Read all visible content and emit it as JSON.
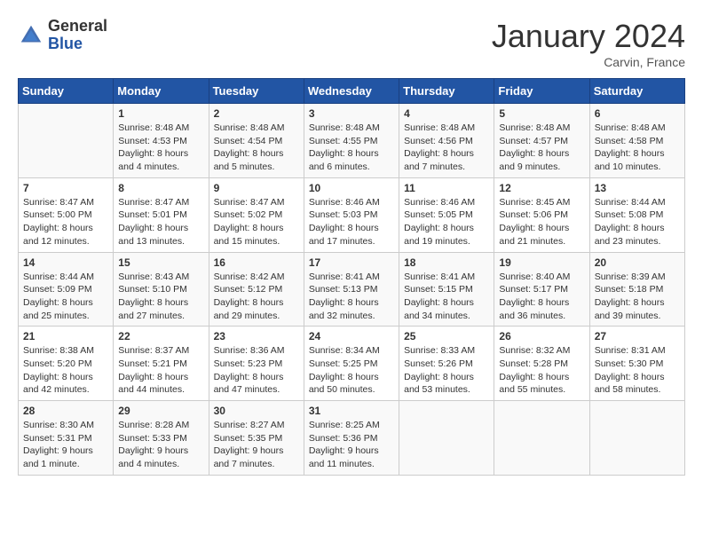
{
  "header": {
    "logo_general": "General",
    "logo_blue": "Blue",
    "month_year": "January 2024",
    "location": "Carvin, France"
  },
  "days_of_week": [
    "Sunday",
    "Monday",
    "Tuesday",
    "Wednesday",
    "Thursday",
    "Friday",
    "Saturday"
  ],
  "weeks": [
    [
      {
        "day": "",
        "sunrise": "",
        "sunset": "",
        "daylight": ""
      },
      {
        "day": "1",
        "sunrise": "Sunrise: 8:48 AM",
        "sunset": "Sunset: 4:53 PM",
        "daylight": "Daylight: 8 hours and 4 minutes."
      },
      {
        "day": "2",
        "sunrise": "Sunrise: 8:48 AM",
        "sunset": "Sunset: 4:54 PM",
        "daylight": "Daylight: 8 hours and 5 minutes."
      },
      {
        "day": "3",
        "sunrise": "Sunrise: 8:48 AM",
        "sunset": "Sunset: 4:55 PM",
        "daylight": "Daylight: 8 hours and 6 minutes."
      },
      {
        "day": "4",
        "sunrise": "Sunrise: 8:48 AM",
        "sunset": "Sunset: 4:56 PM",
        "daylight": "Daylight: 8 hours and 7 minutes."
      },
      {
        "day": "5",
        "sunrise": "Sunrise: 8:48 AM",
        "sunset": "Sunset: 4:57 PM",
        "daylight": "Daylight: 8 hours and 9 minutes."
      },
      {
        "day": "6",
        "sunrise": "Sunrise: 8:48 AM",
        "sunset": "Sunset: 4:58 PM",
        "daylight": "Daylight: 8 hours and 10 minutes."
      }
    ],
    [
      {
        "day": "7",
        "sunrise": "Sunrise: 8:47 AM",
        "sunset": "Sunset: 5:00 PM",
        "daylight": "Daylight: 8 hours and 12 minutes."
      },
      {
        "day": "8",
        "sunrise": "Sunrise: 8:47 AM",
        "sunset": "Sunset: 5:01 PM",
        "daylight": "Daylight: 8 hours and 13 minutes."
      },
      {
        "day": "9",
        "sunrise": "Sunrise: 8:47 AM",
        "sunset": "Sunset: 5:02 PM",
        "daylight": "Daylight: 8 hours and 15 minutes."
      },
      {
        "day": "10",
        "sunrise": "Sunrise: 8:46 AM",
        "sunset": "Sunset: 5:03 PM",
        "daylight": "Daylight: 8 hours and 17 minutes."
      },
      {
        "day": "11",
        "sunrise": "Sunrise: 8:46 AM",
        "sunset": "Sunset: 5:05 PM",
        "daylight": "Daylight: 8 hours and 19 minutes."
      },
      {
        "day": "12",
        "sunrise": "Sunrise: 8:45 AM",
        "sunset": "Sunset: 5:06 PM",
        "daylight": "Daylight: 8 hours and 21 minutes."
      },
      {
        "day": "13",
        "sunrise": "Sunrise: 8:44 AM",
        "sunset": "Sunset: 5:08 PM",
        "daylight": "Daylight: 8 hours and 23 minutes."
      }
    ],
    [
      {
        "day": "14",
        "sunrise": "Sunrise: 8:44 AM",
        "sunset": "Sunset: 5:09 PM",
        "daylight": "Daylight: 8 hours and 25 minutes."
      },
      {
        "day": "15",
        "sunrise": "Sunrise: 8:43 AM",
        "sunset": "Sunset: 5:10 PM",
        "daylight": "Daylight: 8 hours and 27 minutes."
      },
      {
        "day": "16",
        "sunrise": "Sunrise: 8:42 AM",
        "sunset": "Sunset: 5:12 PM",
        "daylight": "Daylight: 8 hours and 29 minutes."
      },
      {
        "day": "17",
        "sunrise": "Sunrise: 8:41 AM",
        "sunset": "Sunset: 5:13 PM",
        "daylight": "Daylight: 8 hours and 32 minutes."
      },
      {
        "day": "18",
        "sunrise": "Sunrise: 8:41 AM",
        "sunset": "Sunset: 5:15 PM",
        "daylight": "Daylight: 8 hours and 34 minutes."
      },
      {
        "day": "19",
        "sunrise": "Sunrise: 8:40 AM",
        "sunset": "Sunset: 5:17 PM",
        "daylight": "Daylight: 8 hours and 36 minutes."
      },
      {
        "day": "20",
        "sunrise": "Sunrise: 8:39 AM",
        "sunset": "Sunset: 5:18 PM",
        "daylight": "Daylight: 8 hours and 39 minutes."
      }
    ],
    [
      {
        "day": "21",
        "sunrise": "Sunrise: 8:38 AM",
        "sunset": "Sunset: 5:20 PM",
        "daylight": "Daylight: 8 hours and 42 minutes."
      },
      {
        "day": "22",
        "sunrise": "Sunrise: 8:37 AM",
        "sunset": "Sunset: 5:21 PM",
        "daylight": "Daylight: 8 hours and 44 minutes."
      },
      {
        "day": "23",
        "sunrise": "Sunrise: 8:36 AM",
        "sunset": "Sunset: 5:23 PM",
        "daylight": "Daylight: 8 hours and 47 minutes."
      },
      {
        "day": "24",
        "sunrise": "Sunrise: 8:34 AM",
        "sunset": "Sunset: 5:25 PM",
        "daylight": "Daylight: 8 hours and 50 minutes."
      },
      {
        "day": "25",
        "sunrise": "Sunrise: 8:33 AM",
        "sunset": "Sunset: 5:26 PM",
        "daylight": "Daylight: 8 hours and 53 minutes."
      },
      {
        "day": "26",
        "sunrise": "Sunrise: 8:32 AM",
        "sunset": "Sunset: 5:28 PM",
        "daylight": "Daylight: 8 hours and 55 minutes."
      },
      {
        "day": "27",
        "sunrise": "Sunrise: 8:31 AM",
        "sunset": "Sunset: 5:30 PM",
        "daylight": "Daylight: 8 hours and 58 minutes."
      }
    ],
    [
      {
        "day": "28",
        "sunrise": "Sunrise: 8:30 AM",
        "sunset": "Sunset: 5:31 PM",
        "daylight": "Daylight: 9 hours and 1 minute."
      },
      {
        "day": "29",
        "sunrise": "Sunrise: 8:28 AM",
        "sunset": "Sunset: 5:33 PM",
        "daylight": "Daylight: 9 hours and 4 minutes."
      },
      {
        "day": "30",
        "sunrise": "Sunrise: 8:27 AM",
        "sunset": "Sunset: 5:35 PM",
        "daylight": "Daylight: 9 hours and 7 minutes."
      },
      {
        "day": "31",
        "sunrise": "Sunrise: 8:25 AM",
        "sunset": "Sunset: 5:36 PM",
        "daylight": "Daylight: 9 hours and 11 minutes."
      },
      {
        "day": "",
        "sunrise": "",
        "sunset": "",
        "daylight": ""
      },
      {
        "day": "",
        "sunrise": "",
        "sunset": "",
        "daylight": ""
      },
      {
        "day": "",
        "sunrise": "",
        "sunset": "",
        "daylight": ""
      }
    ]
  ]
}
